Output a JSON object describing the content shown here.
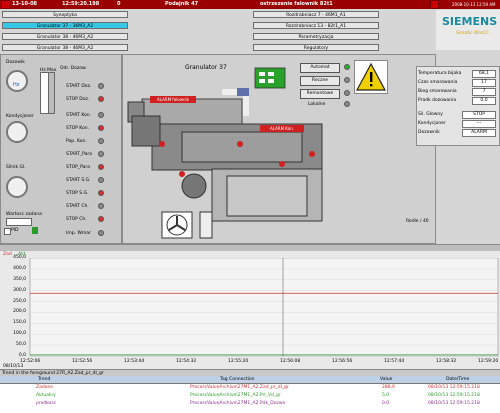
{
  "topbar": {
    "date": "13-10-08",
    "time": "12:59:20.198",
    "counter": "0",
    "station": "Podajnik 47",
    "alarm": "ostrzezenie falownik 82t1",
    "datetime_right": "2008-10-13 12:59 AM"
  },
  "nav": {
    "left": [
      "Synoptyka",
      "Granulator 37 - 36M3_A2",
      "Granulator 38 - 46M3_A2",
      "Granulator 38 - 46M3_A2"
    ],
    "right": [
      "Rozdrabniacz 7 - 46M1_A1",
      "Rozdrabniacz 13 - 82t1_A1",
      "Parametryzacja",
      "Regulatory"
    ]
  },
  "left_panel": {
    "dozowik_label": "Dozowik",
    "unit_hz": "Hz",
    "hz_max_label": "Hz Max",
    "odr_label": "Odr. Dozow.",
    "kondycjoner_label": "Kondycjoner",
    "silnik_label": "Silnik Gl.",
    "wartosc_zadana_label": "Wartosc zadana",
    "pid_label": "PID",
    "buttons": [
      "START Doz.",
      "STOP Doz.",
      "START Kon.",
      "STOP Kon.",
      "Pap. Kon.",
      "START_Para",
      "STOP_Para",
      "START S.G.",
      "STOP S.G.",
      "START Ch.",
      "STOP Ch.",
      "Imp. Wmar"
    ]
  },
  "machine": {
    "title": "Granulator 37",
    "alarm1": "ALARM falownik",
    "alarm2": "ALARM Kon.",
    "footer": "Redle / 40"
  },
  "mode": {
    "auto": "Automat",
    "manual": "Reczne",
    "remote": "Remontowe",
    "local": "Lokalne"
  },
  "params": {
    "rows": [
      {
        "label": "Temperatura bijaka",
        "value": "68,1"
      },
      {
        "label": "Czas smarowania",
        "value": "17"
      },
      {
        "label": "Bieg smarowania",
        "value": "7"
      },
      {
        "label": "Pradk dozowania",
        "value": "0,0"
      }
    ],
    "status_rows": [
      {
        "label": "Sil. Glowny",
        "value": "STOP"
      },
      {
        "label": "Kondycjoner",
        "value": "---"
      },
      {
        "label": "Dozownik",
        "value": "ALARM"
      }
    ]
  },
  "logo": {
    "brand": "SIEMENS",
    "sub": "Simatic WinCC"
  },
  "trend": {
    "y_labels_left": [
      "450,0",
      "400,0",
      "350,0",
      "300,0",
      "250,0",
      "200,0",
      "150,0",
      "100,0",
      "50,0",
      "0,0"
    ],
    "y_labels_top": [
      "Zad",
      "Akt"
    ],
    "x_labels": [
      "12:52:06",
      "12:52:56",
      "12:53:44",
      "12:54:32",
      "12:55:20",
      "12:56:08",
      "12:56:56",
      "12:57:44",
      "12:58:32",
      "12:59:20"
    ],
    "x_date": "08/10/13",
    "status_line": "Trend in the foreground 27R_A2.Zad_pr_dl_gr",
    "table_headers": [
      "Trend",
      "Tag Connection",
      "Value",
      "Date/Time"
    ],
    "table_rows": [
      {
        "trend": "Zadane",
        "tag": "ProcessValueArchive\\27M1_A2.Zad_pr_dl_gr",
        "value": "288,0",
        "date": "08/10/13 12:59:15.218"
      },
      {
        "trend": "Aktualny",
        "tag": "ProcessValueArchive\\27M1_A2.Prl_Vd_gr",
        "value": "5,0",
        "date": "08/10/13 12:59:15.218"
      },
      {
        "trend": "predkosc",
        "tag": "ProcessValueArchive\\27M1_A2.Pdk_Dozwo",
        "value": "0,0",
        "date": "08/10/13 12:59:15.218"
      }
    ],
    "line_colors": {
      "red": "#c83232",
      "green": "#2a9a2a"
    }
  }
}
